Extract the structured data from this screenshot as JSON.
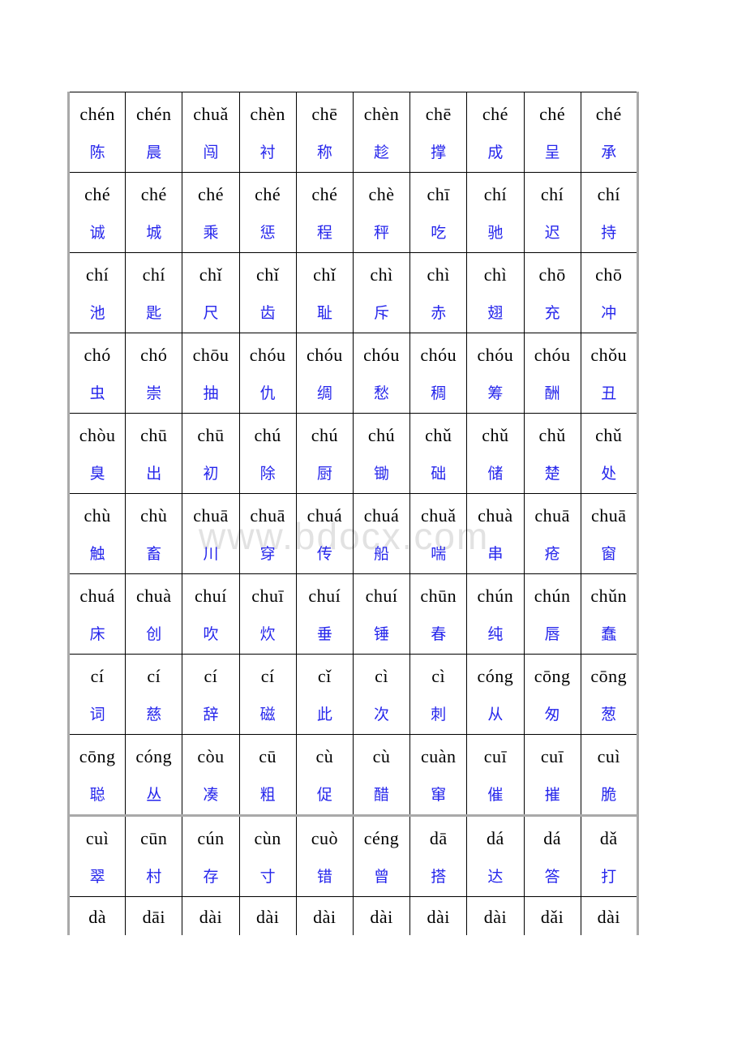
{
  "document": {
    "watermark": "www.bdocx.com",
    "watermark_color": "#e2e2e2",
    "pinyin_color": "#000000",
    "hanzi_color": "#2626ec",
    "columns": 10,
    "rows": 11
  },
  "table": {
    "rows": [
      [
        {
          "pinyin": "chén",
          "hanzi": "陈"
        },
        {
          "pinyin": "chén",
          "hanzi": "晨"
        },
        {
          "pinyin": "chuǎ",
          "hanzi": "闯"
        },
        {
          "pinyin": "chèn",
          "hanzi": "衬"
        },
        {
          "pinyin": "chē",
          "hanzi": "称"
        },
        {
          "pinyin": "chèn",
          "hanzi": "趁"
        },
        {
          "pinyin": "chē",
          "hanzi": "撑"
        },
        {
          "pinyin": "ché",
          "hanzi": "成"
        },
        {
          "pinyin": "ché",
          "hanzi": "呈"
        },
        {
          "pinyin": "ché",
          "hanzi": "承"
        }
      ],
      [
        {
          "pinyin": "ché",
          "hanzi": "诚"
        },
        {
          "pinyin": "ché",
          "hanzi": "城"
        },
        {
          "pinyin": "ché",
          "hanzi": "乘"
        },
        {
          "pinyin": "ché",
          "hanzi": "惩"
        },
        {
          "pinyin": "ché",
          "hanzi": "程"
        },
        {
          "pinyin": "chè",
          "hanzi": "秤"
        },
        {
          "pinyin": "chī",
          "hanzi": "吃"
        },
        {
          "pinyin": "chí",
          "hanzi": "驰"
        },
        {
          "pinyin": "chí",
          "hanzi": "迟"
        },
        {
          "pinyin": "chí",
          "hanzi": "持"
        }
      ],
      [
        {
          "pinyin": "chí",
          "hanzi": "池"
        },
        {
          "pinyin": "chí",
          "hanzi": "匙"
        },
        {
          "pinyin": "chǐ",
          "hanzi": "尺"
        },
        {
          "pinyin": "chǐ",
          "hanzi": "齿"
        },
        {
          "pinyin": "chǐ",
          "hanzi": "耻"
        },
        {
          "pinyin": "chì",
          "hanzi": "斥"
        },
        {
          "pinyin": "chì",
          "hanzi": "赤"
        },
        {
          "pinyin": "chì",
          "hanzi": "翅"
        },
        {
          "pinyin": "chō",
          "hanzi": "充"
        },
        {
          "pinyin": "chō",
          "hanzi": "冲"
        }
      ],
      [
        {
          "pinyin": "chó",
          "hanzi": "虫"
        },
        {
          "pinyin": "chó",
          "hanzi": "崇"
        },
        {
          "pinyin": "chōu",
          "hanzi": "抽"
        },
        {
          "pinyin": "chóu",
          "hanzi": "仇"
        },
        {
          "pinyin": "chóu",
          "hanzi": "绸"
        },
        {
          "pinyin": "chóu",
          "hanzi": "愁"
        },
        {
          "pinyin": "chóu",
          "hanzi": "稠"
        },
        {
          "pinyin": "chóu",
          "hanzi": "筹"
        },
        {
          "pinyin": "chóu",
          "hanzi": "酬"
        },
        {
          "pinyin": "chǒu",
          "hanzi": "丑"
        }
      ],
      [
        {
          "pinyin": "chòu",
          "hanzi": "臭"
        },
        {
          "pinyin": "chū",
          "hanzi": "出"
        },
        {
          "pinyin": "chū",
          "hanzi": "初"
        },
        {
          "pinyin": "chú",
          "hanzi": "除"
        },
        {
          "pinyin": "chú",
          "hanzi": "厨"
        },
        {
          "pinyin": "chú",
          "hanzi": "锄"
        },
        {
          "pinyin": "chǔ",
          "hanzi": "础"
        },
        {
          "pinyin": "chǔ",
          "hanzi": "储"
        },
        {
          "pinyin": "chǔ",
          "hanzi": "楚"
        },
        {
          "pinyin": "chǔ",
          "hanzi": "处"
        }
      ],
      [
        {
          "pinyin": "chù",
          "hanzi": "触"
        },
        {
          "pinyin": "chù",
          "hanzi": "畜"
        },
        {
          "pinyin": "chuā",
          "hanzi": "川"
        },
        {
          "pinyin": "chuā",
          "hanzi": "穿"
        },
        {
          "pinyin": "chuá",
          "hanzi": "传"
        },
        {
          "pinyin": "chuá",
          "hanzi": "船"
        },
        {
          "pinyin": "chuǎ",
          "hanzi": "喘"
        },
        {
          "pinyin": "chuà",
          "hanzi": "串"
        },
        {
          "pinyin": "chuā",
          "hanzi": "疮"
        },
        {
          "pinyin": "chuā",
          "hanzi": "窗"
        }
      ],
      [
        {
          "pinyin": "chuá",
          "hanzi": "床"
        },
        {
          "pinyin": "chuà",
          "hanzi": "创"
        },
        {
          "pinyin": "chuí",
          "hanzi": "吹"
        },
        {
          "pinyin": "chuī",
          "hanzi": "炊"
        },
        {
          "pinyin": "chuí",
          "hanzi": "垂"
        },
        {
          "pinyin": "chuí",
          "hanzi": "锤"
        },
        {
          "pinyin": "chūn",
          "hanzi": "春"
        },
        {
          "pinyin": "chún",
          "hanzi": "纯"
        },
        {
          "pinyin": "chún",
          "hanzi": "唇"
        },
        {
          "pinyin": "chǔn",
          "hanzi": "蠢"
        }
      ],
      [
        {
          "pinyin": "cí",
          "hanzi": "词"
        },
        {
          "pinyin": "cí",
          "hanzi": "慈"
        },
        {
          "pinyin": "cí",
          "hanzi": "辞"
        },
        {
          "pinyin": "cí",
          "hanzi": "磁"
        },
        {
          "pinyin": "cǐ",
          "hanzi": "此"
        },
        {
          "pinyin": "cì",
          "hanzi": "次"
        },
        {
          "pinyin": "cì",
          "hanzi": "刺"
        },
        {
          "pinyin": "cóng",
          "hanzi": "从"
        },
        {
          "pinyin": "cōng",
          "hanzi": "匆"
        },
        {
          "pinyin": "cōng",
          "hanzi": "葱"
        }
      ],
      [
        {
          "pinyin": "cōng",
          "hanzi": "聪"
        },
        {
          "pinyin": "cóng",
          "hanzi": "丛"
        },
        {
          "pinyin": "còu",
          "hanzi": "凑"
        },
        {
          "pinyin": "cū",
          "hanzi": "粗"
        },
        {
          "pinyin": "cù",
          "hanzi": "促"
        },
        {
          "pinyin": "cù",
          "hanzi": "醋"
        },
        {
          "pinyin": "cuàn",
          "hanzi": "窜"
        },
        {
          "pinyin": "cuī",
          "hanzi": "催"
        },
        {
          "pinyin": "cuī",
          "hanzi": "摧"
        },
        {
          "pinyin": "cuì",
          "hanzi": "脆"
        }
      ],
      [
        {
          "pinyin": "cuì",
          "hanzi": "翠"
        },
        {
          "pinyin": "cūn",
          "hanzi": "村"
        },
        {
          "pinyin": "cún",
          "hanzi": "存"
        },
        {
          "pinyin": "cùn",
          "hanzi": "寸"
        },
        {
          "pinyin": "cuò",
          "hanzi": "错"
        },
        {
          "pinyin": "céng",
          "hanzi": "曾"
        },
        {
          "pinyin": "dā",
          "hanzi": "搭"
        },
        {
          "pinyin": "dá",
          "hanzi": "达"
        },
        {
          "pinyin": "dá",
          "hanzi": "答"
        },
        {
          "pinyin": "dǎ",
          "hanzi": "打"
        }
      ],
      [
        {
          "pinyin": "dà",
          "hanzi": ""
        },
        {
          "pinyin": "dāi",
          "hanzi": ""
        },
        {
          "pinyin": "dài",
          "hanzi": ""
        },
        {
          "pinyin": "dài",
          "hanzi": ""
        },
        {
          "pinyin": "dài",
          "hanzi": ""
        },
        {
          "pinyin": "dài",
          "hanzi": ""
        },
        {
          "pinyin": "dài",
          "hanzi": ""
        },
        {
          "pinyin": "dài",
          "hanzi": ""
        },
        {
          "pinyin": "dǎi",
          "hanzi": ""
        },
        {
          "pinyin": "dài",
          "hanzi": ""
        }
      ]
    ]
  }
}
